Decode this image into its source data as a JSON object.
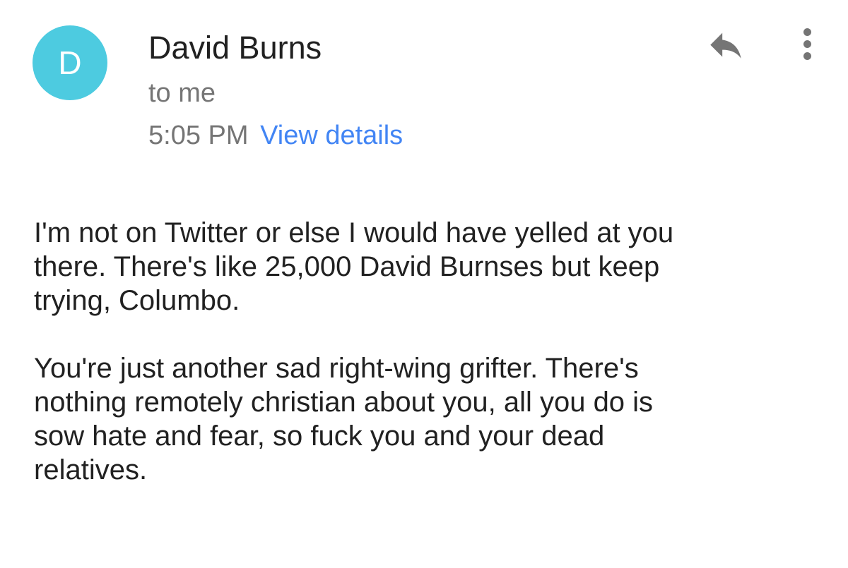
{
  "message": {
    "avatar_letter": "D",
    "avatar_color": "#4dcbe0",
    "sender_name": "David Burns",
    "recipient": "to me",
    "time": "5:05 PM",
    "view_details_label": "View details",
    "link_color": "#4285f4"
  },
  "actions": {
    "reply_icon": "reply-icon",
    "more_icon": "more-vertical-icon"
  },
  "body": {
    "paragraphs": [
      "I'm not on Twitter or else I would have yelled at you\nthere.  There's like 25,000 David Burnses but keep\ntrying, Columbo.",
      "You're just another sad right-wing grifter.  There's\nnothing remotely christian about you, all you do is\nsow hate and fear, so fuck you and your dead\nrelatives."
    ]
  }
}
